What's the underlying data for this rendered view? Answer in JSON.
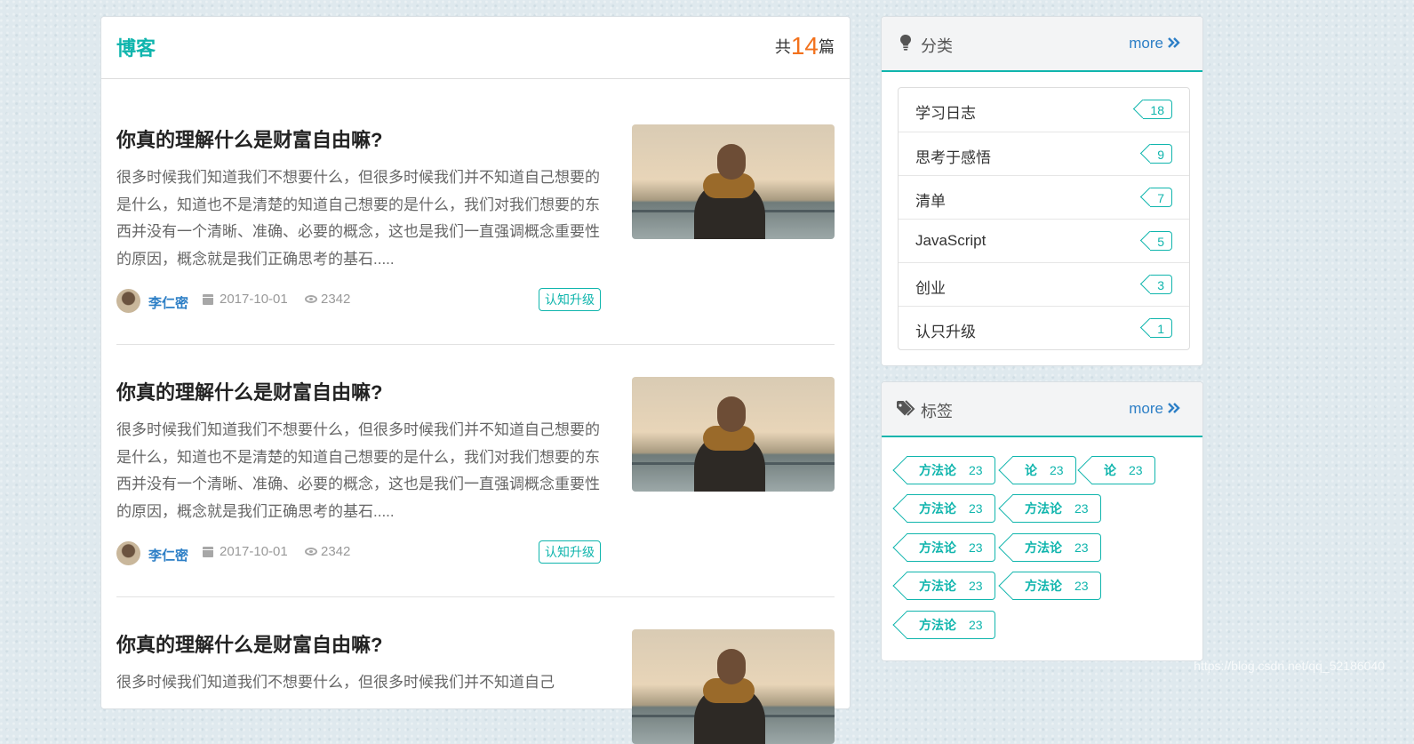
{
  "blog": {
    "title": "博客",
    "count_prefix": "共",
    "count": "14",
    "count_suffix": "篇"
  },
  "posts": [
    {
      "title": "你真的理解什么是财富自由嘛?",
      "excerpt": "很多时候我们知道我们不想要什么，但很多时候我们并不知道自己想要的是什么，知道也不是清楚的知道自己想要的是什么，我们对我们想要的东西并没有一个清晰、准确、必要的概念，这也是我们一直强调概念重要性的原因，概念就是我们正确思考的基石.....",
      "author": "李仁密",
      "date": "2017-10-01",
      "views": "2342",
      "category": "认知升级"
    },
    {
      "title": "你真的理解什么是财富自由嘛?",
      "excerpt": "很多时候我们知道我们不想要什么，但很多时候我们并不知道自己想要的是什么，知道也不是清楚的知道自己想要的是什么，我们对我们想要的东西并没有一个清晰、准确、必要的概念，这也是我们一直强调概念重要性的原因，概念就是我们正确思考的基石.....",
      "author": "李仁密",
      "date": "2017-10-01",
      "views": "2342",
      "category": "认知升级"
    },
    {
      "title": "你真的理解什么是财富自由嘛?",
      "excerpt": "很多时候我们知道我们不想要什么，但很多时候我们并不知道自己"
    }
  ],
  "categories": {
    "title": "分类",
    "more": "more",
    "items": [
      {
        "name": "学习日志",
        "count": "18"
      },
      {
        "name": "思考于感悟",
        "count": "9"
      },
      {
        "name": "清单",
        "count": "7"
      },
      {
        "name": "JavaScript",
        "count": "5"
      },
      {
        "name": "创业",
        "count": "3"
      },
      {
        "name": "认只升级",
        "count": "1"
      }
    ]
  },
  "tags": {
    "title": "标签",
    "more": "more",
    "items": [
      {
        "name": "方法论",
        "count": "23"
      },
      {
        "name": "论",
        "count": "23"
      },
      {
        "name": "论",
        "count": "23"
      },
      {
        "name": "方法论",
        "count": "23"
      },
      {
        "name": "方法论",
        "count": "23"
      },
      {
        "name": "方法论",
        "count": "23"
      },
      {
        "name": "方法论",
        "count": "23"
      },
      {
        "name": "方法论",
        "count": "23"
      },
      {
        "name": "方法论",
        "count": "23"
      },
      {
        "name": "方法论",
        "count": "23"
      }
    ]
  },
  "icons": {
    "categories": "lightbulb-icon",
    "tags": "tags-icon",
    "more": "double-chevron-right-icon",
    "date": "calendar-icon",
    "views": "eye-icon"
  },
  "colors": {
    "accent": "#10b5ad",
    "link": "#2d7fc6",
    "count_highlight": "#f2711c"
  },
  "watermark": "https://blog.csdn.net/qq_52186040"
}
